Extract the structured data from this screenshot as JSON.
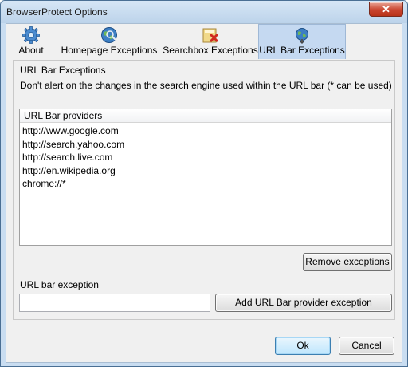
{
  "window": {
    "title": "BrowserProtect Options",
    "close_symbol": "✕"
  },
  "tabs": [
    {
      "label": "About",
      "icon": "gear-icon",
      "active": false
    },
    {
      "label": "Homepage Exceptions",
      "icon": "globe-icon",
      "active": false
    },
    {
      "label": "Searchbox Exceptions",
      "icon": "searchbox-icon",
      "active": false
    },
    {
      "label": "URL Bar Exceptions",
      "icon": "globe-pin-icon",
      "active": true
    }
  ],
  "panel": {
    "group_title": "URL Bar Exceptions",
    "description": "Don't alert on the changes in the search engine used within the URL bar (* can be used)",
    "list": {
      "column_header": "URL Bar providers",
      "items": [
        "http://www.google.com",
        "http://search.yahoo.com",
        "http://search.live.com",
        "http://en.wikipedia.org",
        "chrome://*"
      ]
    },
    "remove_button": "Remove exceptions",
    "input_label": "URL bar exception",
    "input_value": "",
    "add_button": "Add URL Bar provider exception"
  },
  "footer": {
    "ok_label": "Ok",
    "cancel_label": "Cancel"
  },
  "colors": {
    "active_tab": "#c5d9f1",
    "window_frame": "#c9ddf1",
    "close_button": "#c9442e"
  }
}
